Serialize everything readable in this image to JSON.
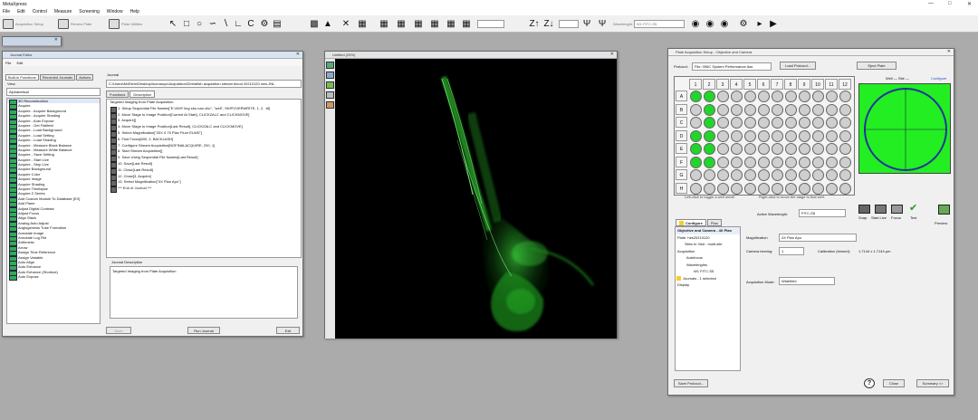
{
  "app": {
    "title": "MetaXpress",
    "menu": [
      "File",
      "Edit",
      "Control",
      "Measure",
      "Screening",
      "Window",
      "Help"
    ]
  },
  "toolbar": {
    "acquisition_setup": "Acquisition Setup",
    "review_plate": "Review Plate",
    "plate_utilities": "Plate Utilities",
    "zoom_a": "Z↑",
    "zoom_b": "Z↓",
    "wavelength_label": "Wavelength:",
    "wavelength_value": "W1 FITC-S5",
    "tool_icons": [
      "pointer-tool-icon",
      "rectangle-tool-icon",
      "ellipse-tool-icon",
      "freehand-tool-icon",
      "line-tool-icon",
      "polyline-tool-icon",
      "arc-tool-icon",
      "color-tool-icon",
      "save-icon",
      "stamp-icon",
      "close-icon",
      "zoom-in-icon",
      "zoom-out-icon",
      "tool-icon-4",
      "tool-icon-5",
      "tool-icon-6",
      "tool-icon-7",
      "tool-icon-8",
      "tool-icon-9"
    ]
  },
  "journal_editor": {
    "title": "Journal Editor",
    "menu": [
      "File",
      "Edit"
    ],
    "tabs": [
      "Built-in Functions",
      "Recorded Journals",
      "Actions"
    ],
    "view_label": "View",
    "sort": "Alphabetical",
    "functions": [
      "3D Reconstruction",
      "Acquire",
      "Acquire - Acquire Background",
      "Acquire - Acquire Shading",
      "Acquire - Auto Expose",
      "Acquire - Get Flatfield",
      "Acquire - Load Background",
      "Acquire - Load Setting",
      "Acquire - Load Shading",
      "Acquire - Measure Black Balance",
      "Acquire - Measure White Balance",
      "Acquire - Save Setting",
      "Acquire - Start Live",
      "Acquire - Stop Live",
      "Acquire Background",
      "Acquire Color",
      "Acquire Image",
      "Acquire Shading",
      "Acquire Timelapse",
      "Acquire Z Series",
      "Add Custom Module To Database [EX]",
      "Add Plane",
      "Adjust Digital Contrast",
      "Adjust Focus",
      "Align Stack",
      "Analog Auto Adjust",
      "Angiogenesis Tube Formation",
      "Annotate Image",
      "Annotate Log File",
      "Arithmetic",
      "Arrow",
      "Assign Time Reference",
      "Assign Variable",
      "Auto Align",
      "Auto Enhance",
      "Auto Enhance (Shortcut)",
      "Auto Expose"
    ],
    "journal_label": "Journal",
    "journal_path": "C:\\Users\\MxElem\\Desktop\\luomaoyu\\Acquisition\\Zebrafish acquisition stream blood 20210120 new.JNL",
    "sub_tabs": [
      "Functions",
      "Description"
    ],
    "journal_steps": [
      "Targeted Imaging from Plate Acquisition",
      "1. Setup Sequential File Names[\"E:\\XMY ling shu nan zhu\", \"well\", SKIPOVERWRITE, 1, 2, .tif]",
      "2. Move Stage to Image Position[Current At Start], CLICKZALC and CLICKMOVE]",
      "3. Acquire[]",
      "4. Move Stage to Image Position[Last Result], CLICKZALC and CLICKMOVE]",
      "5. Select Magnification[\"20X 0.75 Plan Fluor ELWD\"]",
      "6. Find Focus[600, 2, BACKLASH]",
      "7. Configure Stream Acquisition[NOFINALACQUIRE, 200, 1]",
      "8. Start Stream Acquisition[]",
      "9. Save Using Sequential File Names[Last Result]",
      "10. Save[Last Result]",
      "11. Close[Last Result]",
      "12. Close[3, Acquire]",
      "13. Select Magnification[\"4X Plan Apo\"]",
      "*** End of Journal ***"
    ],
    "description_label": "Journal Description",
    "description": "Targeted Imaging from Plate Acquisition",
    "btn_save": "Save",
    "btn_run": "Run Journal",
    "btn_exit": "Exit"
  },
  "image_window": {
    "title": "Untitled (25%)"
  },
  "plate_setup": {
    "title": "Plate Acquisition Setup - Objective and Camera",
    "protocol_label": "Protocol:",
    "protocol_value": "File: 096C System Performance Ass",
    "load_protocol": "Load Protocol...",
    "eject_plate": "Eject Plate",
    "well_site_label": "Well — Site —",
    "configure_label": "Configure",
    "cols": [
      "1",
      "2",
      "3",
      "4",
      "5",
      "6",
      "7",
      "8",
      "9",
      "10",
      "11",
      "12"
    ],
    "rows": [
      "A",
      "B",
      "C",
      "D",
      "E",
      "F",
      "G",
      "H"
    ],
    "hint_left": "Left-click to toggle a well on/off.",
    "hint_right": "Right-click to move the stage to that well.",
    "active_wavelength_label": "Active Wavelength:",
    "active_wavelength_value": "FITC-S5",
    "action_snap": "Snap",
    "action_start_live": "Start Live",
    "action_focus": "Focus",
    "action_test": "Test",
    "action_preview": "Preview",
    "tab_configure": "Configure",
    "tab_plan": "Plan",
    "tree": [
      "Objective and Camera - 4X Plan",
      "Plate: hes20210120",
      "Sites to Visit - multi-site",
      "Acquisition",
      "Autofocus",
      "Wavelengths",
      "W1 FITC-S5",
      "Journals - 1 selected",
      "Display"
    ],
    "magnification_label": "Magnification",
    "magnification_value": "4X Plan Apo",
    "camera_binning_label": "Camera binning:",
    "camera_binning_value": "1",
    "calibration_label": "Calibration (binned):",
    "calibration_value": "1.7144 x 1.7144 µm",
    "acq_mode_label": "Acquisition Mode:",
    "acq_mode_value": "Widefield",
    "btn_save_protocol": "Save Protocol...",
    "btn_close": "Close",
    "btn_summary": "Summary >>",
    "help_icon_text": "?"
  }
}
